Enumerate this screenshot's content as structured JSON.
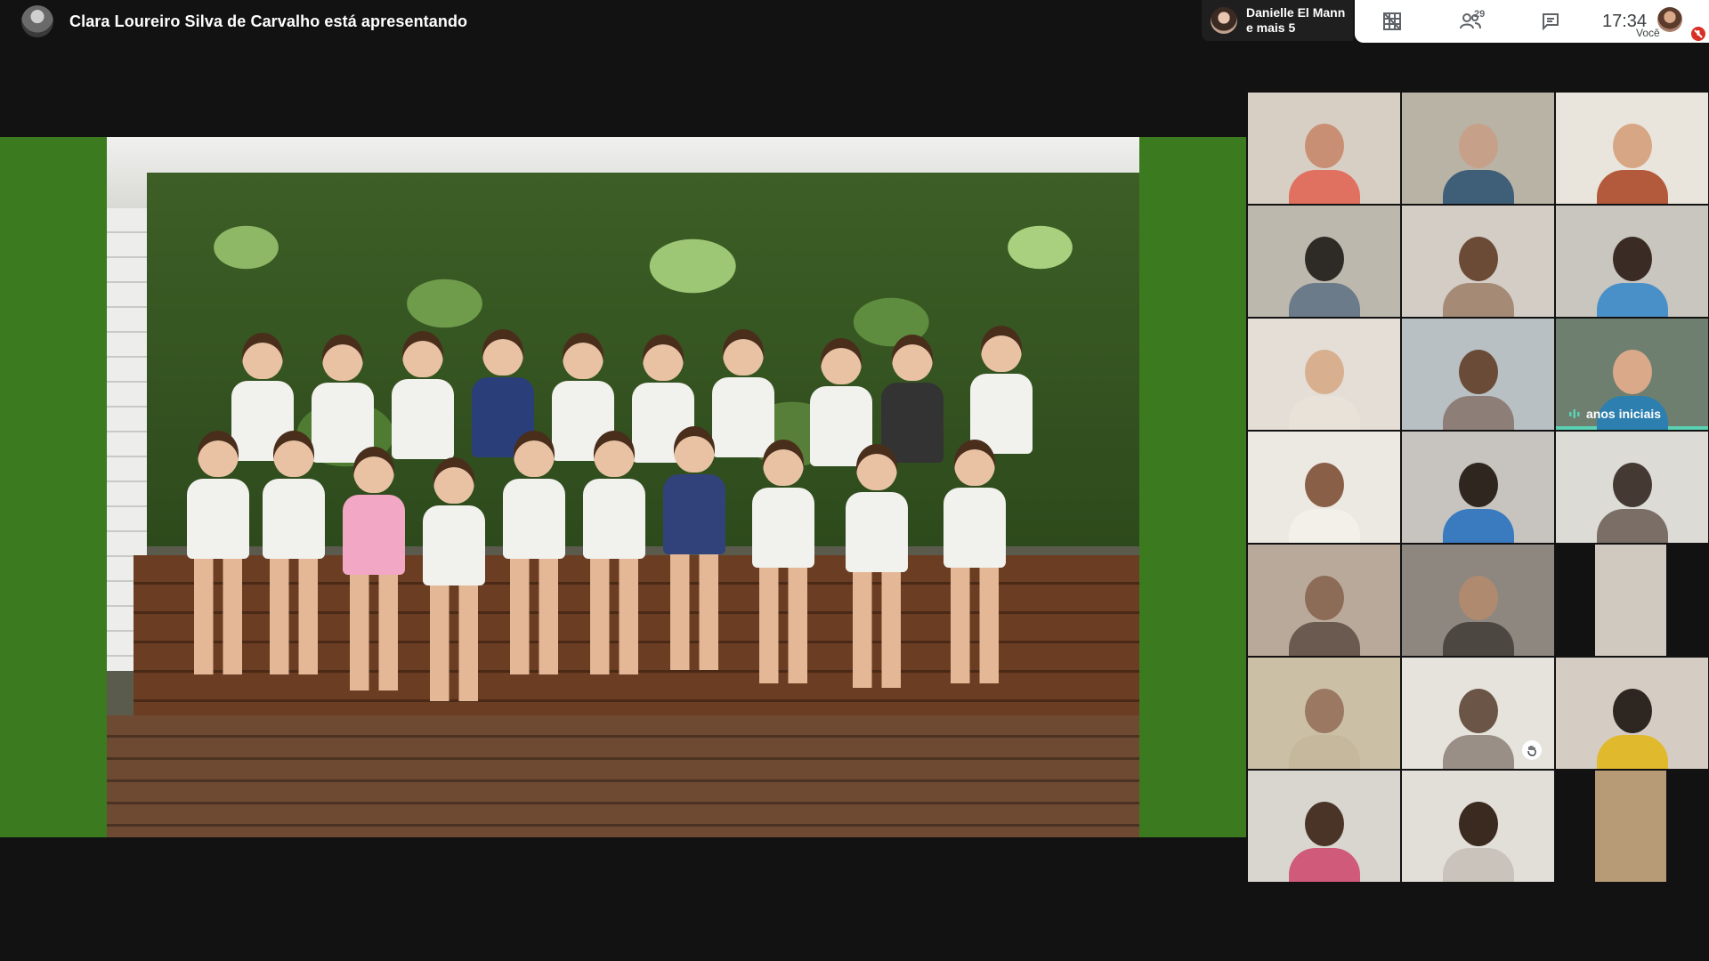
{
  "presenter": {
    "text": "Clara Loureiro Silva de Carvalho está apresentando"
  },
  "speaker": {
    "line1": "Danielle El Mann",
    "line2": "e mais 5"
  },
  "toolbar": {
    "people_count": "29",
    "time": "17:34",
    "you_label": "Você"
  },
  "tiles": [
    {
      "label": ""
    },
    {
      "label": ""
    },
    {
      "label": ""
    },
    {
      "label": ""
    },
    {
      "label": ""
    },
    {
      "label": ""
    },
    {
      "label": ""
    },
    {
      "label": ""
    },
    {
      "label": "anos iniciais"
    },
    {
      "label": ""
    },
    {
      "label": ""
    },
    {
      "label": ""
    },
    {
      "label": ""
    },
    {
      "label": ""
    },
    {
      "label": ""
    },
    {
      "label": ""
    },
    {
      "label": ""
    },
    {
      "label": ""
    },
    {
      "label": ""
    },
    {
      "label": ""
    },
    {
      "label": ""
    }
  ],
  "colors": {
    "presentation_bg": "#3b7a1f",
    "active_speaker": "#5ad1b2",
    "mic_off": "#d93025"
  }
}
